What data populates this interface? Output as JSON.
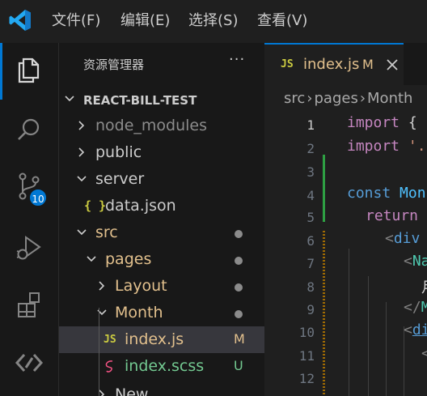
{
  "menu": [
    "文件(F)",
    "编辑(E)",
    "选择(S)",
    "查看(V)"
  ],
  "activity": {
    "scm_badge": "10"
  },
  "explorer": {
    "title": "资源管理器",
    "more": "···",
    "tree": [
      {
        "label": "REACT-BILL-TEST",
        "kind": "root"
      },
      {
        "label": "node_modules",
        "kind": "folder-collapsed"
      },
      {
        "label": "public",
        "kind": "folder-collapsed"
      },
      {
        "label": "server",
        "kind": "folder-expanded"
      },
      {
        "label": "data.json",
        "kind": "file-json",
        "icon": "{ }"
      },
      {
        "label": "src",
        "kind": "folder-expanded"
      },
      {
        "label": "pages",
        "kind": "folder-expanded"
      },
      {
        "label": "Layout",
        "kind": "folder-collapsed"
      },
      {
        "label": "Month",
        "kind": "folder-expanded"
      },
      {
        "label": "index.js",
        "kind": "file-js",
        "icon": "JS",
        "status": "M"
      },
      {
        "label": "index.scss",
        "kind": "file-scss",
        "status": "U"
      },
      {
        "label": "New",
        "kind": "folder-collapsed"
      }
    ]
  },
  "editor": {
    "tab": {
      "icon": "JS",
      "label": "index.js",
      "status": "M"
    },
    "breadcrumb": [
      "src",
      "pages",
      "Month"
    ],
    "lines": {
      "1": [
        "import",
        " {"
      ],
      "2": [
        "import",
        " '."
      ],
      "4": [
        "const",
        " Mon"
      ],
      "5": [
        "return"
      ],
      "6": [
        "<",
        "div"
      ],
      "7": [
        "<",
        "Na"
      ],
      "8": [
        "月"
      ],
      "9": [
        "</",
        "M"
      ],
      "10": [
        "<",
        "di"
      ],
      "11": [
        "<"
      ]
    },
    "line_numbers": [
      "1",
      "2",
      "3",
      "4",
      "5",
      "6",
      "7",
      "8",
      "9",
      "10",
      "11",
      "12"
    ]
  },
  "colors": {
    "accent": "#0078d4",
    "modified": "#e2c08d",
    "untracked": "#73c991",
    "scm_added": "#2ea043"
  }
}
